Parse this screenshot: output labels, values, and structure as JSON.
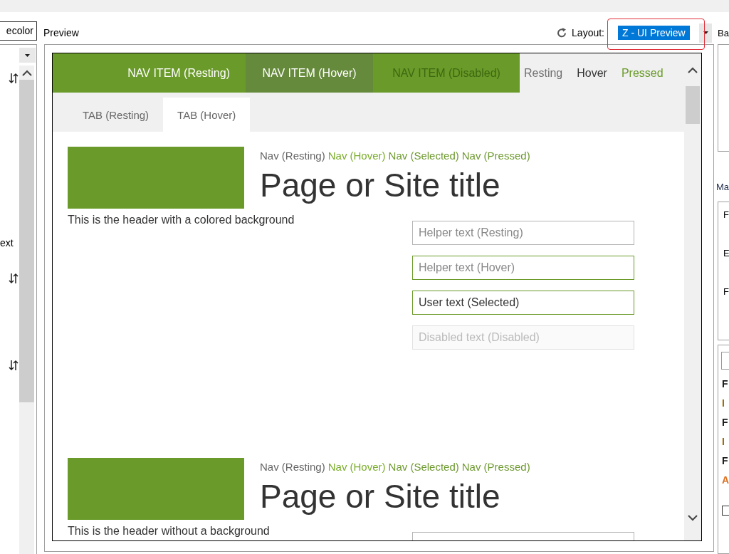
{
  "left_panel": {
    "field_text": "ecolor",
    "label": "ext"
  },
  "preview": {
    "title": "Preview",
    "layout_label": "Layout:",
    "layout_value": "Z - UI Preview",
    "highlighted": true
  },
  "nav_items": [
    {
      "label": "NAV ITEM (Resting)",
      "hover": false,
      "disabled": false
    },
    {
      "label": "NAV ITEM (Hover)",
      "hover": true,
      "disabled": false
    },
    {
      "label": "NAV ITEM (Disabled)",
      "hover": false,
      "disabled": true
    }
  ],
  "nav_states": [
    {
      "label": "Resting",
      "kind": "resting"
    },
    {
      "label": "Hover",
      "kind": "hover"
    },
    {
      "label": "Pressed",
      "kind": "pressed"
    }
  ],
  "tabs": [
    {
      "label": "TAB (Resting)",
      "selected": false
    },
    {
      "label": "TAB (Hover)",
      "selected": true
    }
  ],
  "headers": [
    {
      "nav_links": [
        {
          "label": "Nav (Resting)",
          "kind": "resting"
        },
        {
          "label": "Nav (Hover)",
          "kind": "hover"
        },
        {
          "label": "Nav (Selected)",
          "kind": "selected"
        },
        {
          "label": "Nav (Pressed)",
          "kind": "pressed"
        }
      ],
      "title": "Page or Site title",
      "caption": "This is the header with a colored background",
      "fields": [
        {
          "kind": "resting",
          "placeholder": "Helper text (Resting)"
        },
        {
          "kind": "hover",
          "placeholder": "Helper text (Hover)"
        },
        {
          "kind": "selected",
          "value": "User text (Selected)"
        },
        {
          "kind": "disabled",
          "placeholder": "Disabled text (Disabled)"
        }
      ]
    },
    {
      "nav_links": [
        {
          "label": "Nav (Resting)",
          "kind": "resting"
        },
        {
          "label": "Nav (Hover)",
          "kind": "hover"
        },
        {
          "label": "Nav (Selected)",
          "kind": "selected"
        },
        {
          "label": "Nav (Pressed)",
          "kind": "pressed"
        }
      ],
      "title": "Page or Site title",
      "caption": "This is the header without a background",
      "fields": [
        {
          "kind": "resting"
        }
      ]
    }
  ],
  "right_panel": {
    "top_label": "Ba",
    "section_label": "Ma",
    "box_letters": [
      "F",
      "E",
      "F"
    ],
    "list_letters": [
      {
        "text": "F",
        "color": "#1a1a1a"
      },
      {
        "text": "I",
        "color": "#9a6a00"
      },
      {
        "text": "F",
        "color": "#1a1a1a"
      },
      {
        "text": "I",
        "color": "#9a6a00"
      },
      {
        "text": "F",
        "color": "#1a1a1a"
      },
      {
        "text": "A",
        "color": "#e07020"
      }
    ],
    "checkbox_checked": false
  }
}
